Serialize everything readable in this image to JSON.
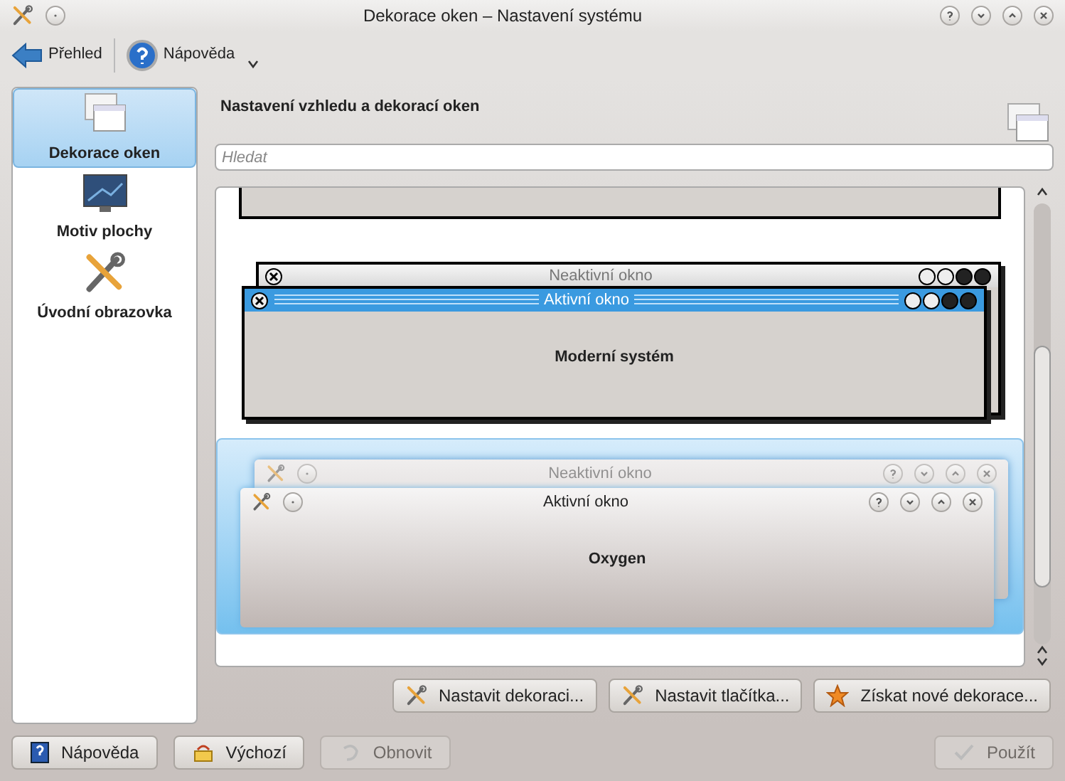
{
  "window": {
    "title": "Dekorace oken – Nastavení systému"
  },
  "toolbar": [
    {
      "label": "Přehled",
      "kind": "back"
    },
    {
      "label": "Nápověda",
      "kind": "help"
    }
  ],
  "sidebar": {
    "items": [
      {
        "label": "Dekorace oken",
        "kind": "windows",
        "selected": true
      },
      {
        "label": "Motiv plochy",
        "kind": "desktop",
        "selected": false
      },
      {
        "label": "Úvodní obrazovka",
        "kind": "tools",
        "selected": false
      }
    ]
  },
  "header": {
    "title": "Nastavení vzhledu a dekorací oken"
  },
  "search": {
    "placeholder": "Hledat"
  },
  "decorations": [
    {
      "kind": "modern",
      "selected": false,
      "inactive_title": "Neaktivní okno",
      "active_title": "Aktivní okno",
      "name": "Moderní systém"
    },
    {
      "kind": "oxygen",
      "selected": true,
      "inactive_title": "Neaktivní okno",
      "active_title": "Aktivní okno",
      "name": "Oxygen"
    }
  ],
  "actions": [
    {
      "label": "Nastavit dekoraci...",
      "kind": "wrench"
    },
    {
      "label": "Nastavit tlačítka...",
      "kind": "wrench"
    },
    {
      "label": "Získat nové dekorace...",
      "kind": "star"
    }
  ],
  "footer": [
    {
      "label": "Nápověda",
      "kind": "help",
      "disabled": false
    },
    {
      "label": "Výchozí",
      "kind": "default",
      "disabled": false
    },
    {
      "label": "Obnovit",
      "kind": "reset",
      "disabled": true
    },
    {
      "label": "Použít",
      "kind": "apply",
      "disabled": true
    }
  ]
}
